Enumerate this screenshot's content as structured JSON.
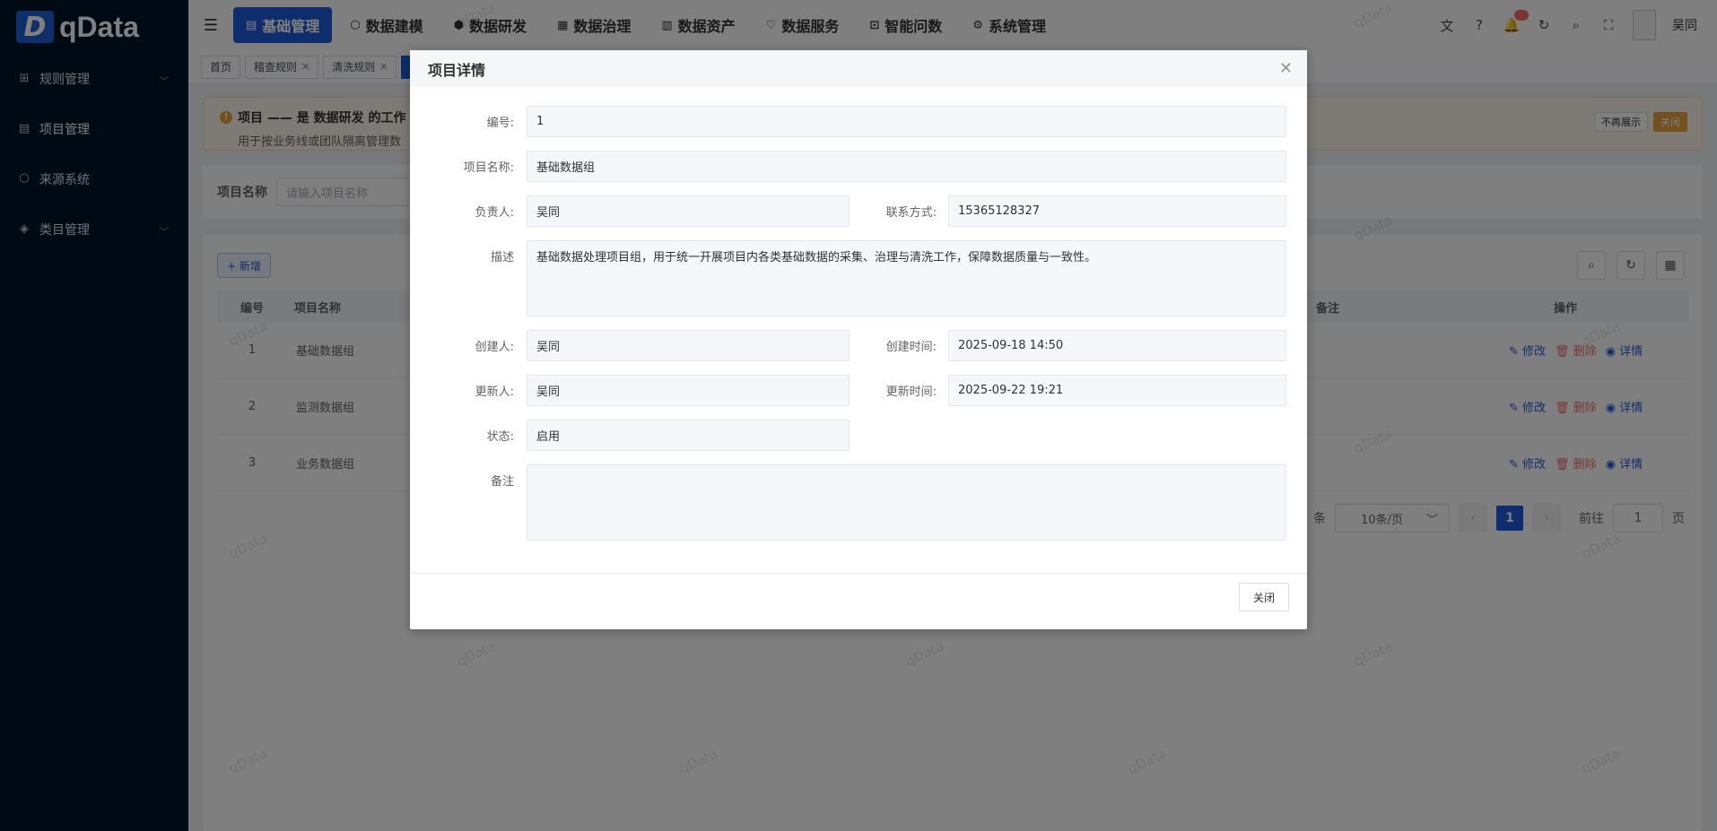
{
  "logo": {
    "mark": "D",
    "text": "qData"
  },
  "sidebar": {
    "items": [
      {
        "label": "规则管理",
        "icon": "grid-icon",
        "expandable": true
      },
      {
        "label": "项目管理",
        "icon": "document-icon",
        "expandable": false
      },
      {
        "label": "来源系统",
        "icon": "cube-icon",
        "expandable": false
      },
      {
        "label": "类目管理",
        "icon": "layers-icon",
        "expandable": true
      }
    ]
  },
  "header": {
    "nav": [
      {
        "label": "基础管理",
        "active": true
      },
      {
        "label": "数据建模",
        "active": false
      },
      {
        "label": "数据研发",
        "active": false
      },
      {
        "label": "数据治理",
        "active": false
      },
      {
        "label": "数据资产",
        "active": false
      },
      {
        "label": "数据服务",
        "active": false
      },
      {
        "label": "智能问数",
        "active": false
      },
      {
        "label": "系统管理",
        "active": false
      }
    ],
    "username": "吴同"
  },
  "tabs": [
    {
      "label": "首页",
      "closable": false
    },
    {
      "label": "稽查规则",
      "closable": true
    },
    {
      "label": "清洗规则",
      "closable": true
    }
  ],
  "alert": {
    "title": "项目 —— 是 数据研发 的工作",
    "subtitle": "用于按业务线或团队隔离管理数",
    "dont_show": "不再展示",
    "close": "关闭"
  },
  "search": {
    "label": "项目名称",
    "placeholder": "请输入项目名称"
  },
  "table": {
    "add_label": "+ 新增",
    "columns": {
      "no": "编号",
      "name": "项目名称",
      "remark": "备注",
      "ops": "操作"
    },
    "rows": [
      {
        "no": "1",
        "name": "基础数据组"
      },
      {
        "no": "2",
        "name": "监测数据组"
      },
      {
        "no": "3",
        "name": "业务数据组"
      }
    ],
    "actions": {
      "edit": "修改",
      "delete": "删除",
      "view": "详情"
    }
  },
  "pagination": {
    "total_suffix": "条",
    "page_size": "10条/页",
    "current": "1",
    "goto": "前往",
    "goto_value": "1",
    "page_suffix": "页"
  },
  "watermark": "qData",
  "dialog": {
    "title": "项目详情",
    "fields": {
      "id": {
        "label": "编号:",
        "value": "1"
      },
      "name": {
        "label": "项目名称:",
        "value": "基础数据组"
      },
      "owner": {
        "label": "负责人:",
        "value": "吴同"
      },
      "contact": {
        "label": "联系方式:",
        "value": "15365128327"
      },
      "desc": {
        "label": "描述",
        "value": "基础数据处理项目组，用于统一开展项目内各类基础数据的采集、治理与清洗工作，保障数据质量与一致性。"
      },
      "creator": {
        "label": "创建人:",
        "value": "吴同"
      },
      "created_at": {
        "label": "创建时间:",
        "value": "2025-09-18 14:50"
      },
      "updater": {
        "label": "更新人:",
        "value": "吴同"
      },
      "updated_at": {
        "label": "更新时间:",
        "value": "2025-09-22 19:21"
      },
      "status": {
        "label": "状态:",
        "value": "启用"
      },
      "remark": {
        "label": "备注",
        "value": ""
      }
    },
    "close_button": "关闭"
  }
}
